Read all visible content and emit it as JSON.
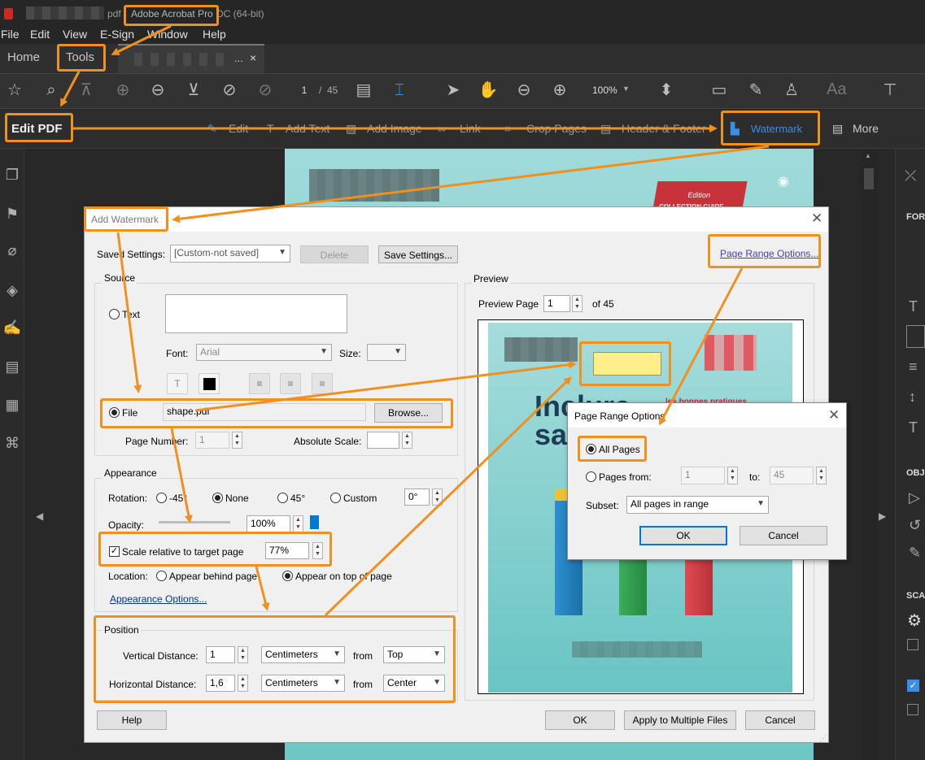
{
  "app": {
    "title_suffix": "pdf",
    "app_name": "Adobe Acrobat Pro",
    "title_tail": "DC (64-bit)"
  },
  "menu": [
    "File",
    "Edit",
    "View",
    "E-Sign",
    "Window",
    "Help"
  ],
  "tabs": {
    "home": "Home",
    "tools": "Tools",
    "doc_suffix": "...",
    "close": "×"
  },
  "toolbar": {
    "page_current": "1",
    "page_sep": "/",
    "page_total": "45",
    "zoom": "100%",
    "aa": "Aa"
  },
  "editbar": {
    "title": "Edit PDF",
    "items": [
      "Edit",
      "Add Text",
      "Add Image",
      "Link",
      "Crop Pages",
      "Header & Footer",
      "Watermark",
      "More"
    ]
  },
  "right_panel": {
    "for": "FOR",
    "obj": "OBJ",
    "sca": "SCA"
  },
  "page_preview": {
    "edition": "Edition",
    "collection": "COLLECTION GUIDE"
  },
  "dialog": {
    "title": "Add Watermark",
    "saved_settings_label": "Saved Settings:",
    "saved_settings_value": "[Custom-not saved]",
    "delete_btn": "Delete",
    "save_settings_btn": "Save Settings...",
    "page_range_link": "Page Range Options...",
    "source": {
      "legend": "Source",
      "text_label": "Text",
      "font_label": "Font:",
      "font_value": "Arial",
      "size_label": "Size:",
      "file_label": "File",
      "file_value": "shape.pdf",
      "browse_btn": "Browse...",
      "page_number_label": "Page Number:",
      "page_number_value": "1",
      "abs_scale_label": "Absolute Scale:"
    },
    "appearance": {
      "legend": "Appearance",
      "rotation_label": "Rotation:",
      "rot_m45": "-45°",
      "rot_none": "None",
      "rot_45": "45°",
      "rot_custom": "Custom",
      "rot_custom_value": "0°",
      "opacity_label": "Opacity:",
      "opacity_value": "100%",
      "opacity_level": 1.0,
      "scale_label": "Scale relative to target page",
      "scale_value": "77%",
      "location_label": "Location:",
      "loc_behind": "Appear behind page",
      "loc_top": "Appear on top of page",
      "appearance_options_link": "Appearance Options..."
    },
    "position": {
      "legend": "Position",
      "vertical_label": "Vertical Distance:",
      "vertical_value": "1",
      "vertical_unit": "Centimeters",
      "vertical_from_label": "from",
      "vertical_from": "Top",
      "horizontal_label": "Horizontal Distance:",
      "horizontal_value": "1,6",
      "horizontal_unit": "Centimeters",
      "horizontal_from_label": "from",
      "horizontal_from": "Center"
    },
    "preview": {
      "legend": "Preview",
      "preview_page_label": "Preview Page",
      "preview_page_value": "1",
      "of_label": "of 45",
      "page_heading_1": "Inclure",
      "page_heading_2": "sa",
      "page_subtitle": "les bonnes pratiques"
    },
    "help_btn": "Help",
    "ok_btn": "OK",
    "apply_multiple_btn": "Apply to Multiple Files",
    "cancel_btn": "Cancel"
  },
  "page_range": {
    "title": "Page Range Options",
    "all_pages": "All Pages",
    "pages_from": "Pages from:",
    "from_value": "1",
    "to_label": "to:",
    "to_value": "45",
    "subset_label": "Subset:",
    "subset_value": "All pages in range",
    "ok_btn": "OK",
    "cancel_btn": "Cancel"
  },
  "colors": {
    "callout": "#f0901e",
    "accent_blue": "#3a8ee6",
    "page_teal": "#6cc7c5",
    "watermark_yellow": "#ffef8a"
  }
}
